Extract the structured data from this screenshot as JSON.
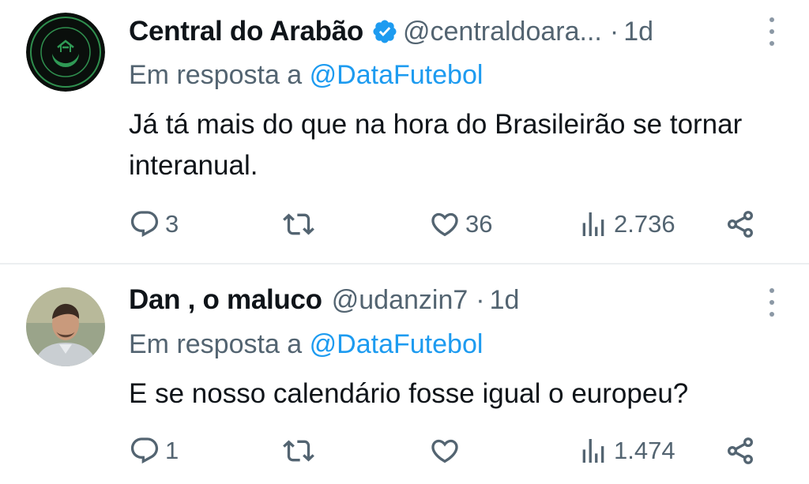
{
  "tweets": [
    {
      "name": "Central do Arabão",
      "verified": true,
      "handle": "@centraldoara...",
      "separator": "·",
      "time": "1d",
      "reply_prefix": "Em resposta a",
      "reply_mention": "@DataFutebol",
      "text": "Já tá mais do que na hora do Brasileirão se tornar interanual.",
      "avatar_text": "CENTRAL DA LIGA DA ARÁBIA SAUDITA",
      "reply_count": "3",
      "retweet_count": "",
      "like_count": "36",
      "view_count": "2.736"
    },
    {
      "name": "Dan , o maluco",
      "verified": false,
      "handle": "@udanzin7",
      "separator": "·",
      "time": "1d",
      "reply_prefix": "Em resposta a",
      "reply_mention": "@DataFutebol",
      "text": "E se nosso calendário fosse igual o europeu?",
      "reply_count": "1",
      "retweet_count": "",
      "like_count": "",
      "view_count": "1.474"
    }
  ],
  "icons": {
    "verified": "verified-badge-icon",
    "more": "more-vertical-icon",
    "reply": "reply-icon",
    "retweet": "retweet-icon",
    "like": "heart-icon",
    "views": "views-icon",
    "share": "share-icon"
  },
  "colors": {
    "text": "#0f1419",
    "secondary": "#536471",
    "accent": "#1d9bf0",
    "divider": "#eceff1"
  }
}
